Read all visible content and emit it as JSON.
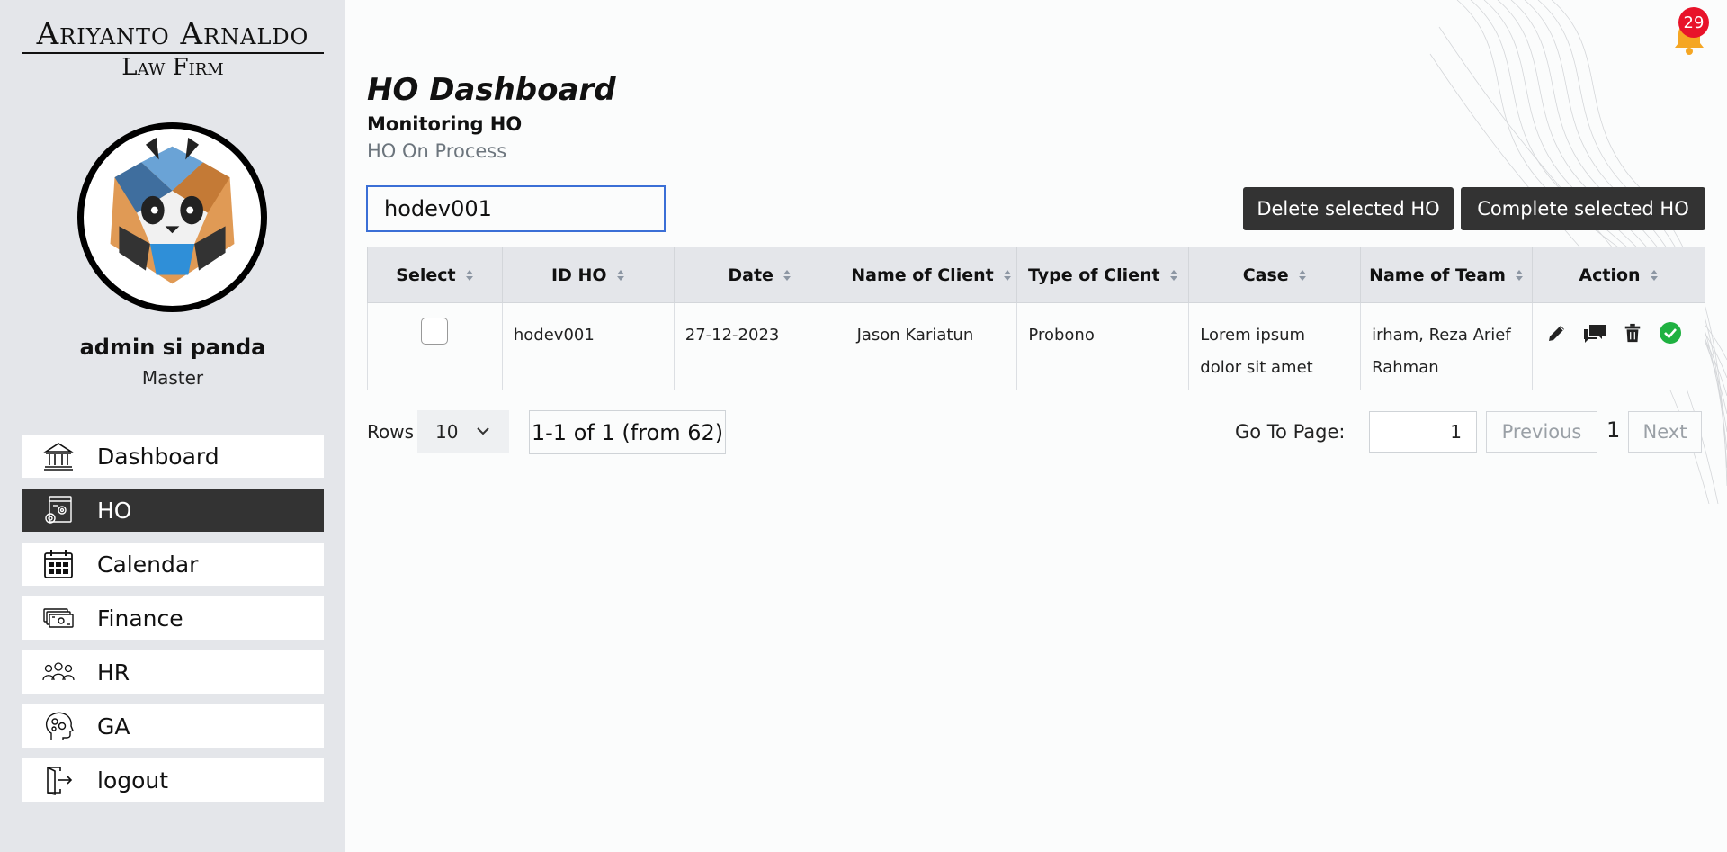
{
  "brand": {
    "line1": "Ariyanto Arnaldo",
    "line2": "Law Firm"
  },
  "user": {
    "name": "admin si panda",
    "role": "Master"
  },
  "sidebar": {
    "items": [
      {
        "label": "Dashboard",
        "icon": "bank-icon",
        "active": false
      },
      {
        "label": "HO",
        "icon": "document-gear-icon",
        "active": true
      },
      {
        "label": "Calendar",
        "icon": "calendar-icon",
        "active": false
      },
      {
        "label": "Finance",
        "icon": "money-icon",
        "active": false
      },
      {
        "label": "HR",
        "icon": "people-group-icon",
        "active": false
      },
      {
        "label": "GA",
        "icon": "head-gears-icon",
        "active": false
      },
      {
        "label": "logout",
        "icon": "logout-icon",
        "active": false
      }
    ]
  },
  "notifications": {
    "count": "29",
    "icon": "bell-icon"
  },
  "page": {
    "title": "HO Dashboard",
    "subtitle": "Monitoring HO",
    "subtitle2": "HO On Process"
  },
  "search": {
    "value": "hodev001"
  },
  "toolbar": {
    "delete_label": "Delete selected HO",
    "complete_label": "Complete selected HO"
  },
  "table": {
    "columns": [
      "Select",
      "ID HO",
      "Date",
      "Name of Client",
      "Type of Client",
      "Case",
      "Name of Team",
      "Action"
    ],
    "rows": [
      {
        "id": "hodev001",
        "date": "27-12-2023",
        "client": "Jason Kariatun",
        "type": "Probono",
        "case": "Lorem ipsum dolor sit amet",
        "team": "irham, Reza Arief Rahman"
      }
    ]
  },
  "pagination": {
    "rows_label": "Rows",
    "rows_value": "10",
    "range_text": "1-1 of 1 (from 62)",
    "goto_label": "Go To Page:",
    "goto_value": "1",
    "previous_label": "Previous",
    "current_page": "1",
    "next_label": "Next"
  },
  "colors": {
    "accent_dark": "#333333",
    "badge": "#e8132a",
    "complete": "#1fb141",
    "sidebar_bg": "#e4e6ea"
  }
}
